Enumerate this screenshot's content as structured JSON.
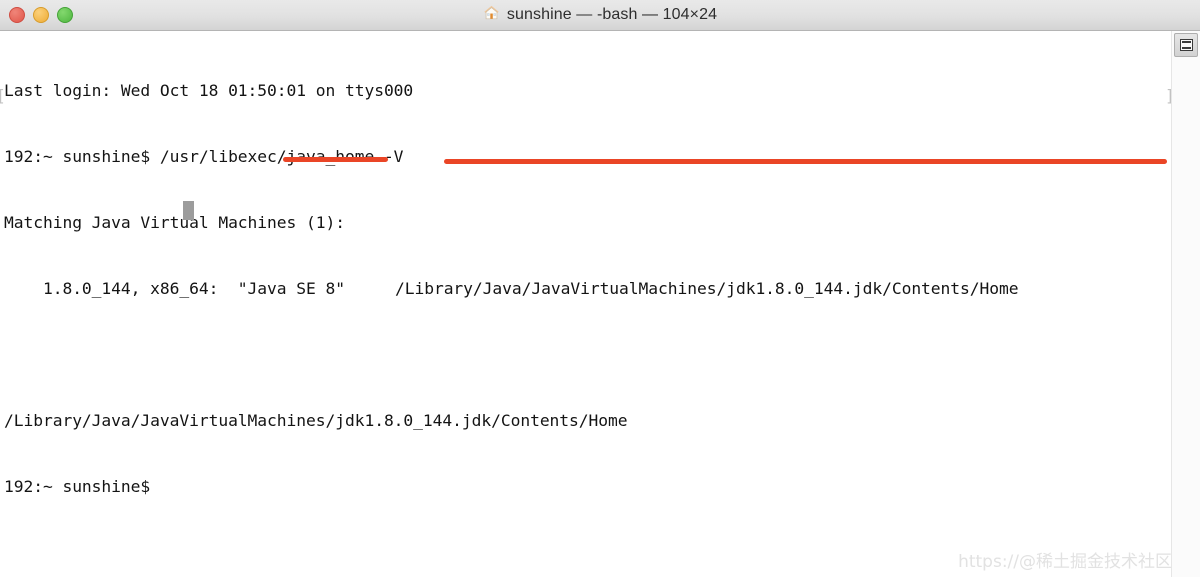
{
  "window": {
    "title": "sunshine — -bash — 104×24",
    "title_icon": "house-icon",
    "traffic_lights": [
      {
        "name": "close-button",
        "label": "Close",
        "color": "#ed6b5e"
      },
      {
        "name": "minimize-button",
        "label": "Minimize",
        "color": "#f5bf4f"
      },
      {
        "name": "zoom-button",
        "label": "Zoom",
        "color": "#61c555"
      }
    ]
  },
  "terminal": {
    "lines": [
      "Last login: Wed Oct 18 01:50:01 on ttys000",
      "192:~ sunshine$ /usr/libexec/java_home -V",
      "Matching Java Virtual Machines (1):",
      "    1.8.0_144, x86_64:\t\"Java SE 8\"\t/Library/Java/JavaVirtualMachines/jdk1.8.0_144.jdk/Contents/Home",
      "",
      "/Library/Java/JavaVirtualMachines/jdk1.8.0_144.jdk/Contents/Home",
      "192:~ sunshine$ "
    ],
    "line_1": "Last login: Wed Oct 18 01:50:01 on ttys000",
    "line_2": "192:~ sunshine$ /usr/libexec/java_home -V",
    "line_3": "Matching Java Virtual Machines (1):",
    "line_4_left": "    1.8.0_144, x86_64:  \"Java SE 8\"",
    "line_4_right": "/Library/Java/JavaVirtualMachines/jdk1.8.0_144.jdk/Contents/Home",
    "line_6": "/Library/Java/JavaVirtualMachines/jdk1.8.0_144.jdk/Contents/Home",
    "line_7": "192:~ sunshine$",
    "edge_bracket_left": "[",
    "edge_bracket_right": "]",
    "command": "/usr/libexec/java_home -V",
    "prompt": "192:~ sunshine$",
    "jvm_count_text": "Matching Java Virtual Machines (1):",
    "jvm_version": "1.8.0_144",
    "jvm_arch": "x86_64",
    "jvm_name": "\"Java SE 8\"",
    "jvm_home": "/Library/Java/JavaVirtualMachines/jdk1.8.0_144.jdk/Contents/Home",
    "columns": "104",
    "rows": "24"
  },
  "annotations": {
    "color": "#ea4526",
    "items": [
      {
        "name": "java-se-8-underline",
        "target": "\"Java SE 8\""
      },
      {
        "name": "jdk-path-underline",
        "target": "/Library/Java/JavaVirtualMachines/jdk1.8.0_144.jdk/Contents/Home"
      }
    ]
  },
  "scrollbar": {
    "split_pane_icon": "split-pane-icon"
  },
  "watermark": {
    "text": "https://@稀土掘金技术社区"
  }
}
